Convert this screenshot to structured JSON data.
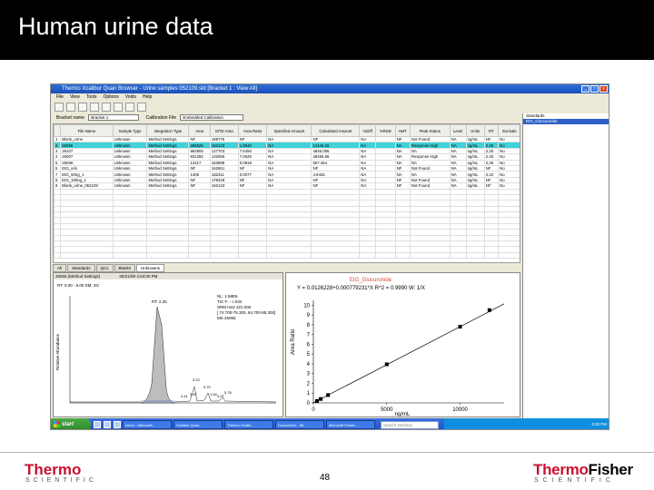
{
  "slide": {
    "title": "Human urine data",
    "page_number": "48",
    "logo_left": {
      "brand": "Thermo",
      "tagline": "SCIENTIFIC"
    },
    "logo_right": {
      "brand_a": "Thermo",
      "brand_b": "Fisher",
      "tagline": "SCIENTIFIC"
    },
    "colors": {
      "header_bg": "#000000",
      "logo_red": "#c8102e",
      "highlight_row": "#3fd2d8",
      "calib_title": "#d24a3a"
    }
  },
  "app": {
    "title": "Thermo Xcalibur Quan Browser - Urine samples 052109.sld [Bracket 1 : View All]",
    "menu": [
      "File",
      "View",
      "Tools",
      "Options",
      "Voids",
      "Help"
    ],
    "filter_label": "Bracket name",
    "bracket_value": "Bracket 1",
    "calfile_label": "Calibration File",
    "calfile_value": "Embedded Calibration",
    "tree": [
      "Standards",
      "EtG_Glucuronide"
    ],
    "tree_selected": 1
  },
  "table": {
    "columns": [
      "",
      "File Name",
      "Sample Type",
      "Integration Type",
      "Area",
      "ISTD Area",
      "Area Ratio",
      "Specified Amount",
      "Calculated Amount",
      "%Diff",
      "%RSD",
      "AMT",
      "Peak Status",
      "Level",
      "Units",
      "RT",
      "Exclude"
    ],
    "rows": [
      [
        "1",
        "Blank_urine",
        "Unknown",
        "Method Settings",
        "NF",
        "199776",
        "NF",
        "NA",
        "NF",
        "NA",
        "",
        "NF",
        "Not Found",
        "NA",
        "ng/mL",
        "NF",
        "No"
      ],
      [
        "2",
        "26065",
        "Unknown",
        "Method Settings",
        "286625",
        "152133",
        "1.8840",
        "NA",
        "12446.26",
        "NA",
        "",
        "NA",
        "Response High",
        "NA",
        "ng/mL",
        "2.25",
        "No"
      ],
      [
        "3",
        "26107",
        "Unknown",
        "Method Settings",
        "962905",
        "127703",
        "7.5450",
        "NA",
        "4846.095",
        "NA",
        "",
        "NA",
        "NA",
        "NA",
        "ng/mL",
        "2.25",
        "No"
      ],
      [
        "4",
        "26007",
        "Unknown",
        "Method Settings",
        "931392",
        "132066",
        "7.0525",
        "NA",
        "46455.95",
        "NA",
        "",
        "NA",
        "Response High",
        "NA",
        "ng/mL",
        "2.25",
        "No"
      ],
      [
        "5",
        "26068",
        "Unknown",
        "Method Settings",
        "13417",
        "163998",
        "0.0818",
        "NA",
        "567.454",
        "NA",
        "",
        "NA",
        "NA",
        "NA",
        "ng/mL",
        "2.25",
        "No"
      ],
      [
        "6",
        "EtG_urin",
        "Unknown",
        "Method Settings",
        "NF",
        "162651",
        "NF",
        "NA",
        "NF",
        "NA",
        "",
        "NF",
        "Not Found",
        "NA",
        "ng/mL",
        "NF",
        "No"
      ],
      [
        "7",
        "EtG_50ng_1",
        "Unknown",
        "Method Settings",
        "1408",
        "182311",
        "0.0077",
        "NA",
        "4.9426",
        "NA",
        "",
        "NA",
        "NA",
        "NA",
        "ng/mL",
        "2.22",
        "No"
      ],
      [
        "8",
        "EtG_100ng_1",
        "Unknown",
        "Method Settings",
        "NF",
        "179428",
        "NF",
        "NA",
        "NF",
        "NA",
        "",
        "NF",
        "Not Found",
        "NA",
        "ng/mL",
        "NF",
        "No"
      ],
      [
        "9",
        "Blank_urine_052109",
        "Unknown",
        "Method Settings",
        "NF",
        "162143",
        "NF",
        "NA",
        "NF",
        "NA",
        "",
        "NF",
        "Not Found",
        "NA",
        "ng/mL",
        "NF",
        "No"
      ]
    ],
    "highlight_row_index": 1
  },
  "tabs": {
    "items": [
      "All",
      "Standards",
      "QCs",
      "Blanks",
      "Unknowns"
    ],
    "active": 4
  },
  "chromatogram": {
    "header": [
      "26065 (Method Settings)",
      "05/21/09 4:04:00 PM"
    ],
    "info_line": "RT: 0.00 - 5.00 SM: 3G",
    "legend_lines": [
      "NL: 1.58E6",
      "TIC F: - c ESI",
      "SRM ms2 221.000",
      "[ 74.700-75.300, 84.700-85.300]",
      "MS 26065"
    ],
    "ylabel": "Relative Abundance",
    "main_peak_rt": "2.25",
    "other_labels": [
      "3.23",
      "3.70",
      "3.87",
      "1.54",
      "4.41",
      "4.97",
      "5.78"
    ]
  },
  "calibration": {
    "title": "EtG_Glucuronide",
    "equation": "Y = 0.0126228+0.000779231*X   R^2 = 0.9990   W: 1/X",
    "ylabel": "Area Ratio",
    "xlabel": "ng/mL",
    "y_ticks": [
      "0",
      "1",
      "2",
      "3",
      "4",
      "5",
      "6",
      "7",
      "8",
      "9",
      "10"
    ],
    "x_ticks": [
      "0",
      "5000",
      "10000"
    ]
  },
  "chart_data": {
    "type": "scatter",
    "title": "EtG_Glucuronide",
    "xlabel": "ng/mL",
    "ylabel": "Area Ratio",
    "xlim": [
      0,
      13000
    ],
    "ylim": [
      0,
      10.5
    ],
    "points": [
      {
        "x": 250,
        "y": 0.2
      },
      {
        "x": 500,
        "y": 0.4
      },
      {
        "x": 1000,
        "y": 0.8
      },
      {
        "x": 5000,
        "y": 3.95
      },
      {
        "x": 10000,
        "y": 7.8
      },
      {
        "x": 12000,
        "y": 9.5
      }
    ],
    "fit_line": {
      "intercept": 0.0126228,
      "slope": 0.000779231
    }
  },
  "taskbar": {
    "start_label": "start",
    "buttons": [
      "Inbox - Microsoft...",
      "Xcalibur Quan...",
      "Thermo Xcalib...",
      "Document1 - Mi...",
      "Microsoft Power..."
    ],
    "search_placeholder": "Search Desktop",
    "clock": "4:29 PM"
  }
}
